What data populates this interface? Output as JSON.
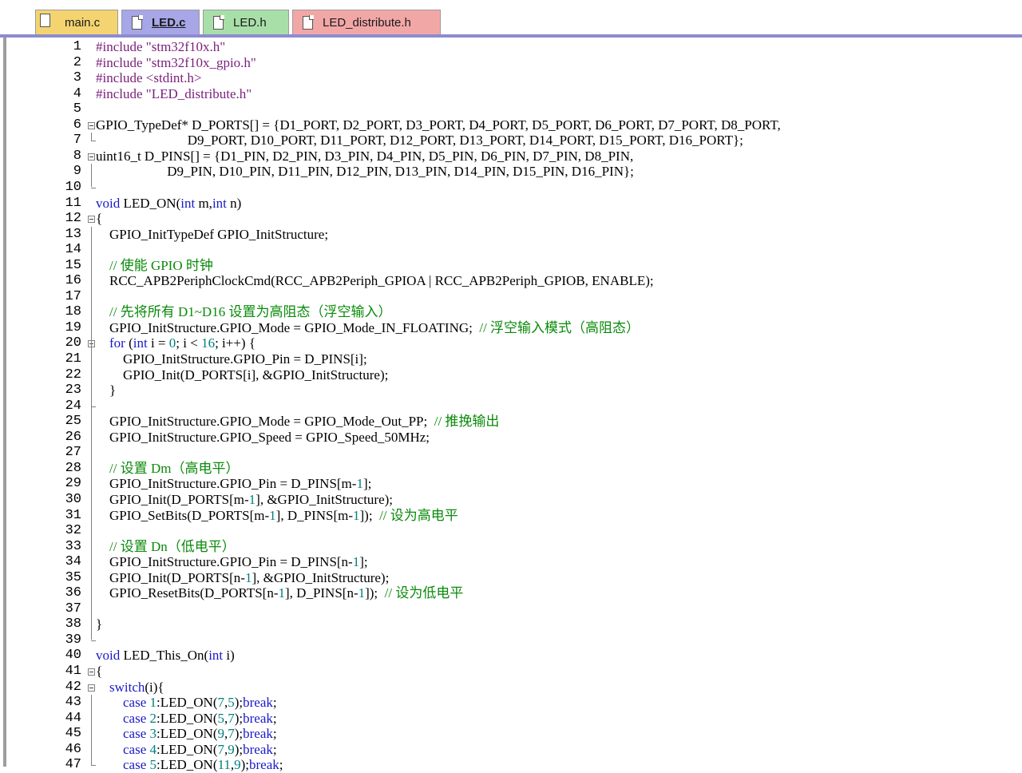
{
  "tabs": [
    {
      "name": "main-c",
      "label": "main.c"
    },
    {
      "name": "led-c",
      "label": "LED.c"
    },
    {
      "name": "led-h",
      "label": "LED.h"
    },
    {
      "name": "led-distribute-h",
      "label": "LED_distribute.h"
    }
  ],
  "editor": {
    "active_tab": "LED.c",
    "lines": [
      {
        "n": "1",
        "html": "<span class=\"pp\">#include \"stm32f10x.h\"</span>"
      },
      {
        "n": "2",
        "html": "<span class=\"pp\">#include \"stm32f10x_gpio.h\"</span>"
      },
      {
        "n": "3",
        "html": "<span class=\"pp\">#include &lt;stdint.h&gt;</span>"
      },
      {
        "n": "4",
        "html": "<span class=\"pp\">#include \"LED_distribute.h\"</span>"
      },
      {
        "n": "5",
        "html": ""
      },
      {
        "n": "6",
        "html": "GPIO_TypeDef* D_PORTS[] = {D1_PORT, D2_PORT, D3_PORT, D4_PORT, D5_PORT, D6_PORT, D7_PORT, D8_PORT,"
      },
      {
        "n": "7",
        "html": "                           D9_PORT, D10_PORT, D11_PORT, D12_PORT, D13_PORT, D14_PORT, D15_PORT, D16_PORT};"
      },
      {
        "n": "8",
        "html": "uint16_t D_PINS[] = {D1_PIN, D2_PIN, D3_PIN, D4_PIN, D5_PIN, D6_PIN, D7_PIN, D8_PIN,"
      },
      {
        "n": "9",
        "html": "                     D9_PIN, D10_PIN, D11_PIN, D12_PIN, D13_PIN, D14_PIN, D15_PIN, D16_PIN};"
      },
      {
        "n": "10",
        "html": ""
      },
      {
        "n": "11",
        "html": "<span class=\"kw\">void</span> LED_ON(<span class=\"kw\">int</span> m,<span class=\"kw\">int</span> n)"
      },
      {
        "n": "12",
        "html": "{"
      },
      {
        "n": "13",
        "html": "    GPIO_InitTypeDef GPIO_InitStructure;"
      },
      {
        "n": "14",
        "html": ""
      },
      {
        "n": "15",
        "html": "    <span class=\"cm\">// 使能 GPIO 时钟</span>"
      },
      {
        "n": "16",
        "html": "    RCC_APB2PeriphClockCmd(RCC_APB2Periph_GPIOA | RCC_APB2Periph_GPIOB, ENABLE);"
      },
      {
        "n": "17",
        "html": ""
      },
      {
        "n": "18",
        "html": "    <span class=\"cm\">// 先将所有 D1~D16 设置为高阻态（浮空输入）</span>"
      },
      {
        "n": "19",
        "html": "    GPIO_InitStructure.GPIO_Mode = GPIO_Mode_IN_FLOATING;  <span class=\"cm\">// 浮空输入模式（高阻态）</span>"
      },
      {
        "n": "20",
        "html": "    <span class=\"kw\">for</span> (<span class=\"kw\">int</span> i = <span class=\"num\">0</span>; i &lt; <span class=\"num\">16</span>; i++) {"
      },
      {
        "n": "21",
        "html": "        GPIO_InitStructure.GPIO_Pin = D_PINS[i];"
      },
      {
        "n": "22",
        "html": "        GPIO_Init(D_PORTS[i], &amp;GPIO_InitStructure);"
      },
      {
        "n": "23",
        "html": "    }"
      },
      {
        "n": "24",
        "html": ""
      },
      {
        "n": "25",
        "html": "    GPIO_InitStructure.GPIO_Mode = GPIO_Mode_Out_PP;  <span class=\"cm\">// 推挽输出</span>"
      },
      {
        "n": "26",
        "html": "    GPIO_InitStructure.GPIO_Speed = GPIO_Speed_50MHz;"
      },
      {
        "n": "27",
        "html": ""
      },
      {
        "n": "28",
        "html": "    <span class=\"cm\">// 设置 Dm（高电平）</span>"
      },
      {
        "n": "29",
        "html": "    GPIO_InitStructure.GPIO_Pin = D_PINS[m-<span class=\"num\">1</span>];"
      },
      {
        "n": "30",
        "html": "    GPIO_Init(D_PORTS[m-<span class=\"num\">1</span>], &amp;GPIO_InitStructure);"
      },
      {
        "n": "31",
        "html": "    GPIO_SetBits(D_PORTS[m-<span class=\"num\">1</span>], D_PINS[m-<span class=\"num\">1</span>]);  <span class=\"cm\">// 设为高电平</span>"
      },
      {
        "n": "32",
        "html": ""
      },
      {
        "n": "33",
        "html": "    <span class=\"cm\">// 设置 Dn（低电平）</span>"
      },
      {
        "n": "34",
        "html": "    GPIO_InitStructure.GPIO_Pin = D_PINS[n-<span class=\"num\">1</span>];"
      },
      {
        "n": "35",
        "html": "    GPIO_Init(D_PORTS[n-<span class=\"num\">1</span>], &amp;GPIO_InitStructure);"
      },
      {
        "n": "36",
        "html": "    GPIO_ResetBits(D_PORTS[n-<span class=\"num\">1</span>], D_PINS[n-<span class=\"num\">1</span>]);  <span class=\"cm\">// 设为低电平</span>"
      },
      {
        "n": "37",
        "html": ""
      },
      {
        "n": "38",
        "html": "}"
      },
      {
        "n": "39",
        "html": ""
      },
      {
        "n": "40",
        "html": "<span class=\"kw\">void</span> LED_This_On(<span class=\"kw\">int</span> i)"
      },
      {
        "n": "41",
        "html": "{"
      },
      {
        "n": "42",
        "html": "    <span class=\"kw\">switch</span>(i){"
      },
      {
        "n": "43",
        "html": "        <span class=\"kw\">case</span> <span class=\"num\">1</span>:LED_ON(<span class=\"num\">7</span>,<span class=\"num\">5</span>);<span class=\"kw\">break</span>;"
      },
      {
        "n": "44",
        "html": "        <span class=\"kw\">case</span> <span class=\"num\">2</span>:LED_ON(<span class=\"num\">5</span>,<span class=\"num\">7</span>);<span class=\"kw\">break</span>;"
      },
      {
        "n": "45",
        "html": "        <span class=\"kw\">case</span> <span class=\"num\">3</span>:LED_ON(<span class=\"num\">9</span>,<span class=\"num\">7</span>);<span class=\"kw\">break</span>;"
      },
      {
        "n": "46",
        "html": "        <span class=\"kw\">case</span> <span class=\"num\">4</span>:LED_ON(<span class=\"num\">7</span>,<span class=\"num\">9</span>);<span class=\"kw\">break</span>;"
      },
      {
        "n": "47",
        "html": "        <span class=\"kw\">case</span> <span class=\"num\">5</span>:LED_ON(<span class=\"num\">11</span>,<span class=\"num\">9</span>);<span class=\"kw\">break</span>;"
      }
    ],
    "fold_markers": [
      "6",
      "8",
      "12",
      "20",
      "41",
      "42"
    ]
  },
  "colors": {
    "preprocessor": "#7a1f7a",
    "keyword": "#1919c8",
    "number": "#008080",
    "comment": "#0a8a0a",
    "active_tab": "#a7a6e6"
  }
}
